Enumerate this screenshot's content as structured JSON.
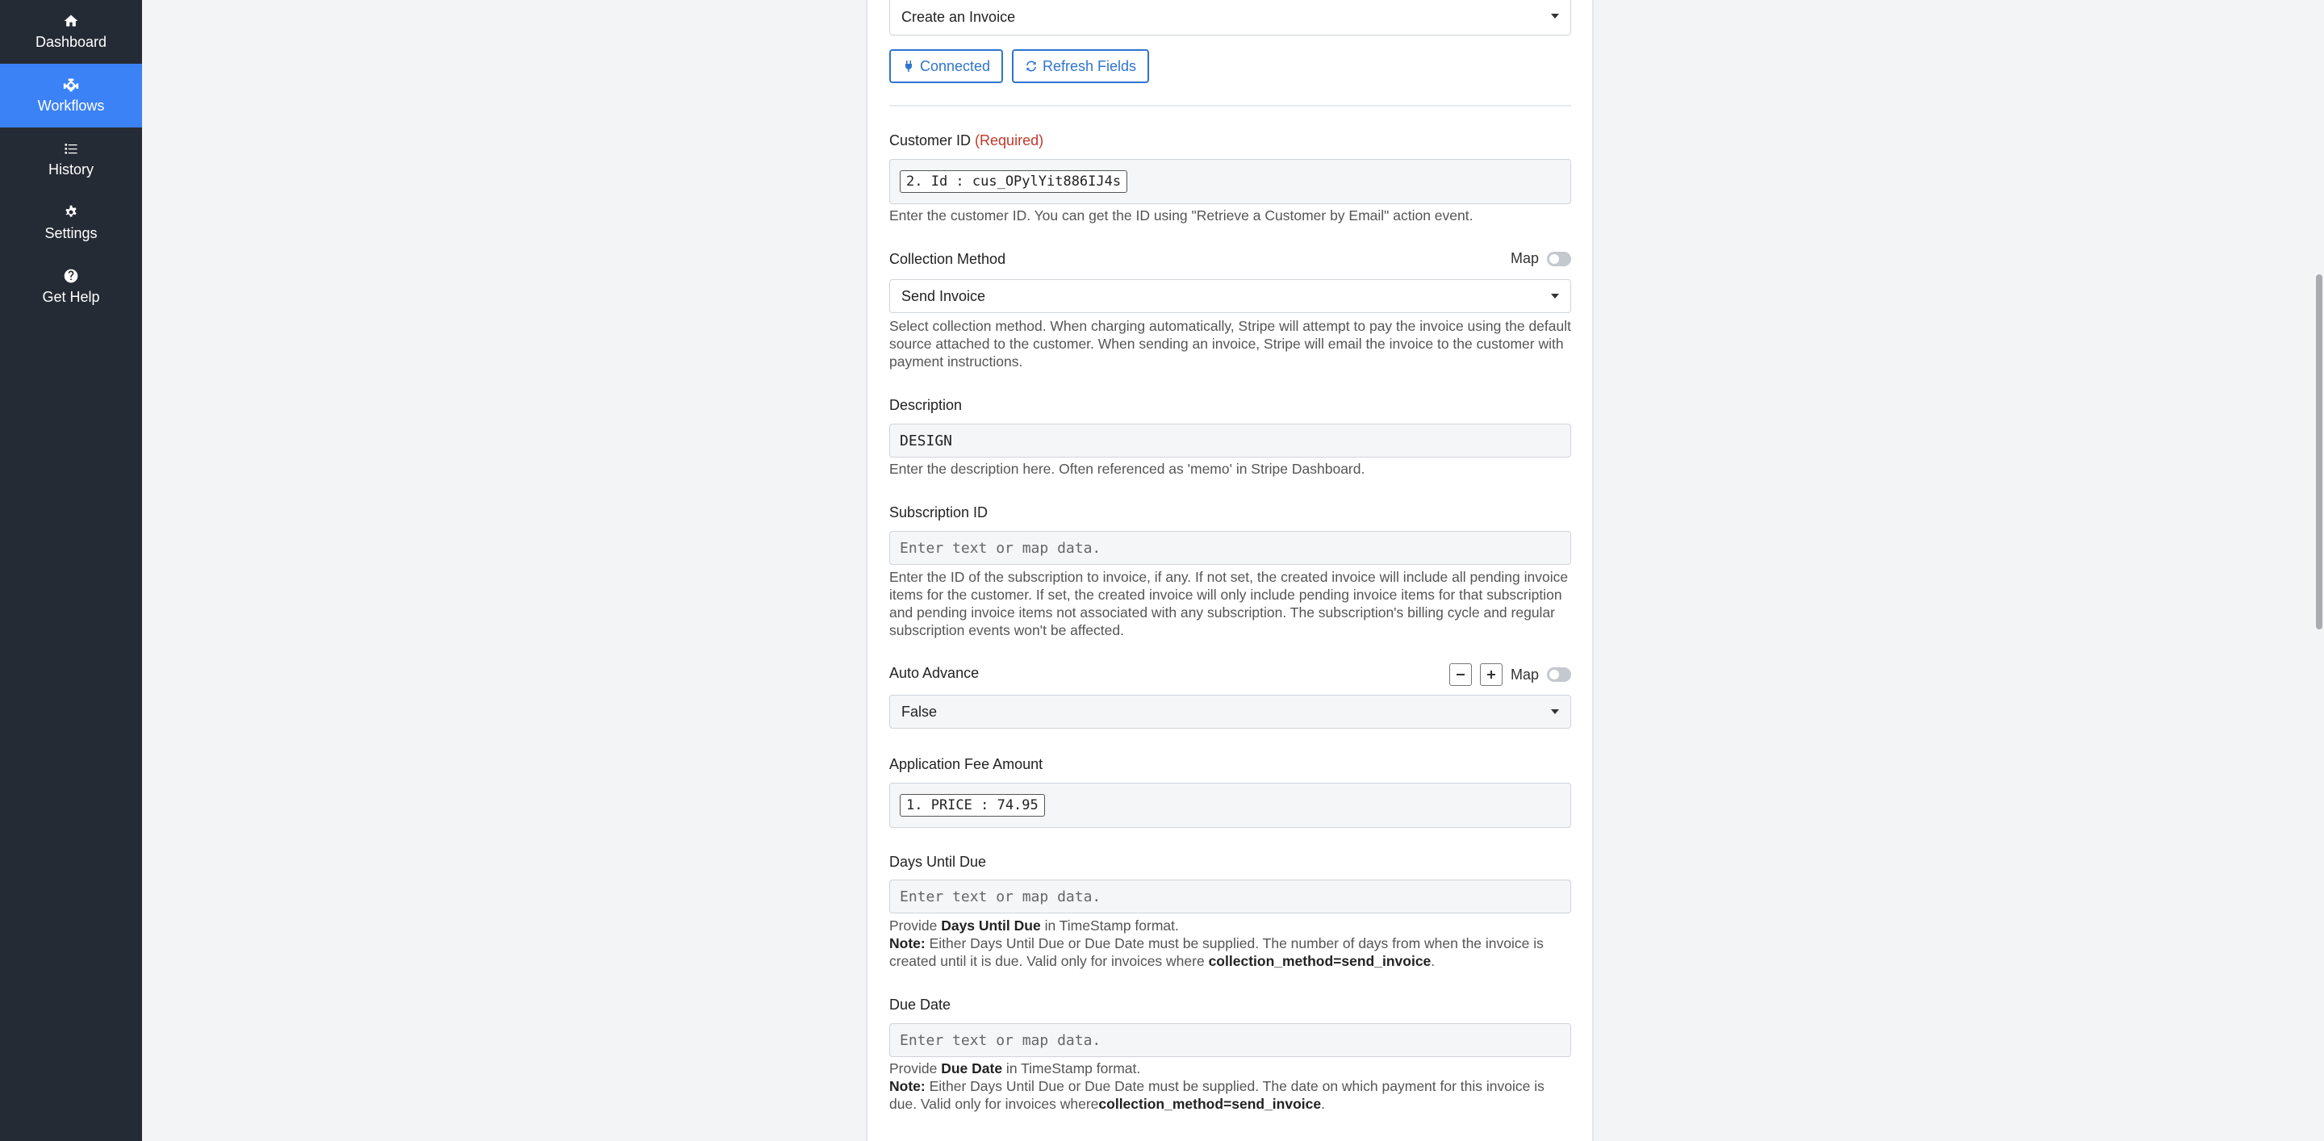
{
  "sidebar": {
    "items": [
      {
        "label": "Dashboard",
        "icon": "home-icon",
        "active": false
      },
      {
        "label": "Workflows",
        "icon": "workflow-icon",
        "active": true
      },
      {
        "label": "History",
        "icon": "list-icon",
        "active": false
      },
      {
        "label": "Settings",
        "icon": "gear-icon",
        "active": false
      },
      {
        "label": "Get Help",
        "icon": "question-icon",
        "active": false
      }
    ]
  },
  "action": {
    "selected": "Create an Invoice",
    "connected_label": "Connected",
    "refresh_label": "Refresh Fields"
  },
  "fields": {
    "customer_id": {
      "label": "Customer ID",
      "required": "(Required)",
      "chip": "2. Id : cus_OPylYit886IJ4s",
      "help": "Enter the customer ID. You can get the ID using \"Retrieve a Customer by Email\" action event."
    },
    "collection_method": {
      "label": "Collection Method",
      "map_label": "Map",
      "value": "Send Invoice",
      "help": "Select collection method. When charging automatically, Stripe will attempt to pay the invoice using the default source attached to the customer. When sending an invoice, Stripe will email the invoice to the customer with payment instructions."
    },
    "description": {
      "label": "Description",
      "value": "DESIGN",
      "help": "Enter the description here. Often referenced as 'memo' in Stripe Dashboard."
    },
    "subscription_id": {
      "label": "Subscription ID",
      "placeholder": "Enter text or map data.",
      "help": "Enter the ID of the subscription to invoice, if any. If not set, the created invoice will include all pending invoice items for the customer. If set, the created invoice will only include pending invoice items for that subscription and pending invoice items not associated with any subscription. The subscription's billing cycle and regular subscription events won't be affected."
    },
    "auto_advance": {
      "label": "Auto Advance",
      "map_label": "Map",
      "value": "False"
    },
    "application_fee": {
      "label": "Application Fee Amount",
      "chip": "1. PRICE : 74.95"
    },
    "days_until_due": {
      "label": "Days Until Due",
      "placeholder": "Enter text or map data.",
      "help_pre": "Provide ",
      "help_bold": "Days Until Due",
      "help_post": " in TimeStamp format.",
      "note_label": "Note:",
      "note_text": " Either Days Until Due or Due Date must be supplied. The number of days from when the invoice is created until it is due. Valid only for invoices where ",
      "note_code": "collection_method=send_invoice",
      "note_end": "."
    },
    "due_date": {
      "label": "Due Date",
      "placeholder": "Enter text or map data.",
      "help_pre": "Provide ",
      "help_bold": "Due Date",
      "help_post": " in TimeStamp format.",
      "note_label": "Note:",
      "note_text": " Either Days Until Due or Due Date must be supplied. The date on which payment for this invoice is due. Valid only for invoices where",
      "note_code": "collection_method=send_invoice",
      "note_end": "."
    }
  },
  "colors": {
    "sidebar_bg": "#252b35",
    "active_blue": "#3b82f6",
    "button_blue": "#2f74d0",
    "required_red": "#c0392b"
  }
}
